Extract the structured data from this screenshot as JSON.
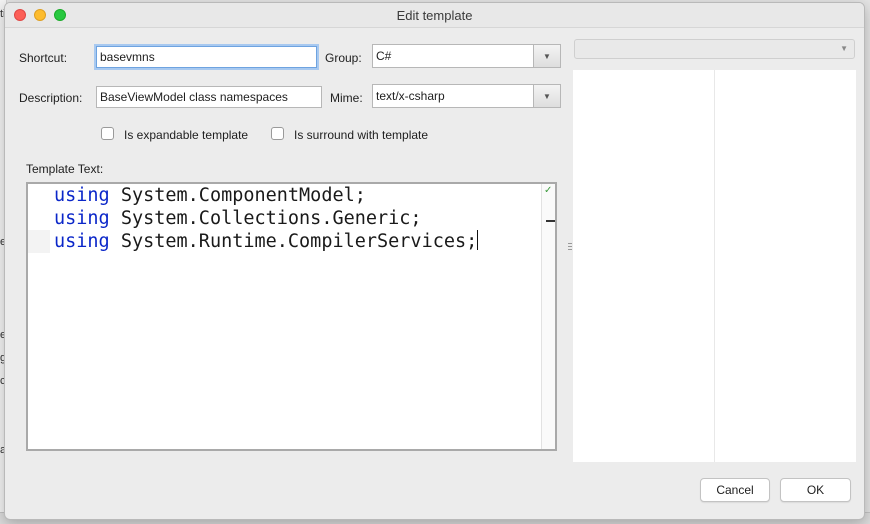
{
  "window": {
    "title": "Edit template"
  },
  "background": {
    "fragments": [
      "ti",
      "el",
      "er",
      "g",
      "c",
      "al"
    ]
  },
  "form": {
    "shortcut_label": "Shortcut:",
    "shortcut_value": "basevmns",
    "group_label": "Group:",
    "group_value": "C#",
    "description_label": "Description:",
    "description_value": "BaseViewModel class namespaces",
    "mime_label": "Mime:",
    "mime_value": "text/x-csharp",
    "expandable_label": "Is expandable template",
    "expandable_checked": false,
    "surround_label": "Is surround with template",
    "surround_checked": false,
    "template_text_label": "Template Text:"
  },
  "editor": {
    "lines": [
      {
        "keyword": "using",
        "rest": " System.ComponentModel;"
      },
      {
        "keyword": "using",
        "rest": " System.Collections.Generic;"
      },
      {
        "keyword": "using",
        "rest": " System.Runtime.CompilerServices;"
      }
    ],
    "status_icon": "checkmark-icon"
  },
  "buttons": {
    "cancel": "Cancel",
    "ok": "OK"
  },
  "colors": {
    "keyword": "#0b27c9",
    "focus": "#6ea3e0",
    "close": "#fc5f57",
    "minimize": "#fdbc2e",
    "maximize": "#28c840"
  }
}
